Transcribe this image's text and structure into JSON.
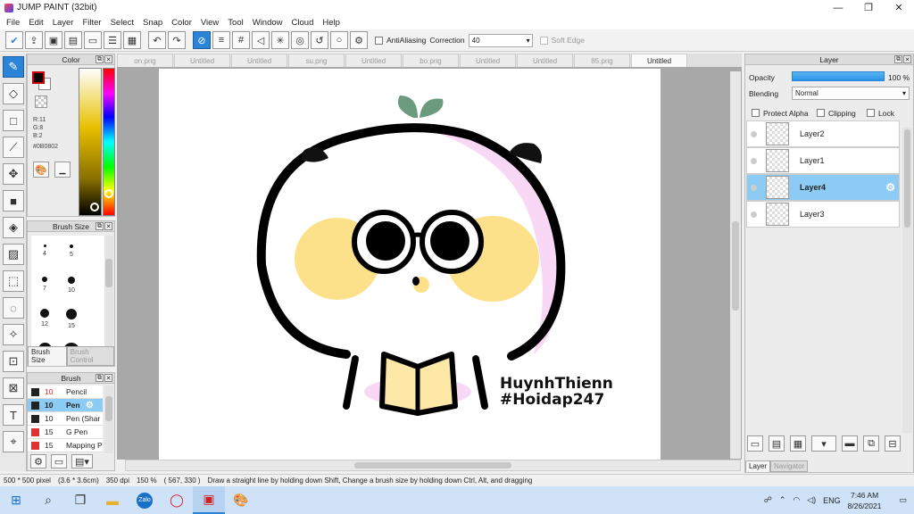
{
  "app": {
    "title": "JUMP PAINT (32bit)",
    "win_min": "—",
    "win_max": "❐",
    "win_close": "✕"
  },
  "menu": [
    "File",
    "Edit",
    "Layer",
    "Filter",
    "Select",
    "Snap",
    "Color",
    "View",
    "Tool",
    "Window",
    "Cloud",
    "Help"
  ],
  "toolbar": {
    "antialiasing_label": "AntiAliasing",
    "correction_label": "Correction",
    "correction_value": "40",
    "soft_edge_label": "Soft Edge"
  },
  "color_panel": {
    "title": "Color",
    "r": "R:11",
    "g": "G:8",
    "b": "B:2",
    "hex": "#0B0802",
    "fg_color": "#0B0802"
  },
  "brush_size_panel": {
    "title": "Brush Size",
    "sizes": [
      "4",
      "5",
      "7",
      "10",
      "12",
      "15"
    ],
    "tab_active": "Brush Size",
    "tab_inactive": "Brush Control"
  },
  "brush_panel": {
    "title": "Brush",
    "items": [
      {
        "size": "10",
        "name": "Pencil",
        "color": "#222222",
        "red": true,
        "selected": false
      },
      {
        "size": "10",
        "name": "Pen",
        "color": "#222222",
        "red": false,
        "selected": true
      },
      {
        "size": "10",
        "name": "Pen (Shar",
        "color": "#222222",
        "red": false,
        "selected": false
      },
      {
        "size": "15",
        "name": "G Pen",
        "color": "#e03030",
        "red": false,
        "selected": false
      },
      {
        "size": "15",
        "name": "Mapping P",
        "color": "#e03030",
        "red": false,
        "selected": false
      }
    ]
  },
  "doc_tabs": [
    "on.png",
    "Untitled",
    "Untitled",
    "su.png",
    "Untitled",
    "bo.png",
    "Untitled",
    "Untitled",
    "85.png",
    "Untitled"
  ],
  "canvas_text": {
    "line1": "HuynhThienn",
    "line2": "#Hoidap247"
  },
  "layer_panel": {
    "title": "Layer",
    "opacity_label": "Opacity",
    "opacity_value": "100 %",
    "opacity_fraction": 1.0,
    "blending_label": "Blending",
    "blending_value": "Normal",
    "protect_alpha": "Protect Alpha",
    "clipping": "Clipping",
    "lock": "Lock",
    "layers": [
      "Layer2",
      "Layer1",
      "Layer4",
      "Layer3"
    ],
    "selected_layer": "Layer4",
    "tab_active": "Layer",
    "tab_inactive": "Navigator"
  },
  "status": {
    "size": "500 * 500 pixel",
    "cm": "(3.6 * 3.6cm)",
    "dpi": "350 dpi",
    "zoom": "150 %",
    "coords": "( 567, 330 )",
    "hint": "Draw a straight line by holding down Shift, Change a brush size by holding down Ctrl, Alt, and dragging"
  },
  "taskbar": {
    "lang": "ENG",
    "time": "7:46 AM",
    "date": "8/26/2021",
    "zalo": "Zalo"
  },
  "colors": {
    "accent": "#2b84d8",
    "selected_row": "#8ccbf3"
  }
}
